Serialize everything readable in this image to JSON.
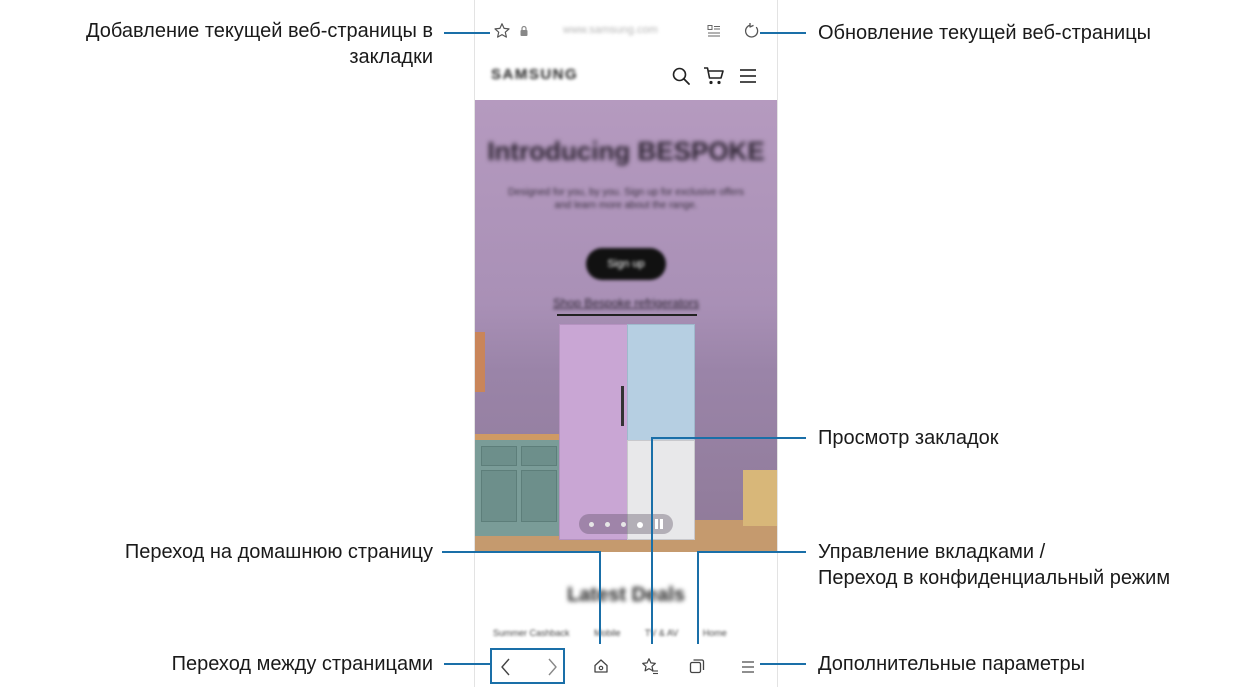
{
  "browser": {
    "url": "www.samsung.com",
    "site_logo": "SAMSUNG",
    "hero": {
      "title": "Introducing BESPOKE",
      "subtitle": "Designed for you, by you. Sign up for exclusive offers and learn more about the range.",
      "button": "Sign up",
      "link": "Shop Bespoke refrigerators"
    },
    "deals": {
      "title": "Latest Deals",
      "tabs": [
        "Summer Cashback",
        "Mobile",
        "TV & AV",
        "Home"
      ]
    }
  },
  "callouts": {
    "bookmark_add": [
      "Добавление текущей веб-страницы в",
      "закладки"
    ],
    "refresh": "Обновление текущей веб-страницы",
    "view_bookmarks": "Просмотр закладок",
    "home": "Переход на домашнюю страницу",
    "tabs": [
      "Управление вкладками /",
      "Переход в конфиденциальный режим"
    ],
    "navigate": "Переход между страницами",
    "more": "Дополнительные параметры"
  },
  "colors": {
    "hero_bg": "#a990b6",
    "leader_line": "#1a6fa8",
    "nav_highlight": "#1a6fa8"
  }
}
